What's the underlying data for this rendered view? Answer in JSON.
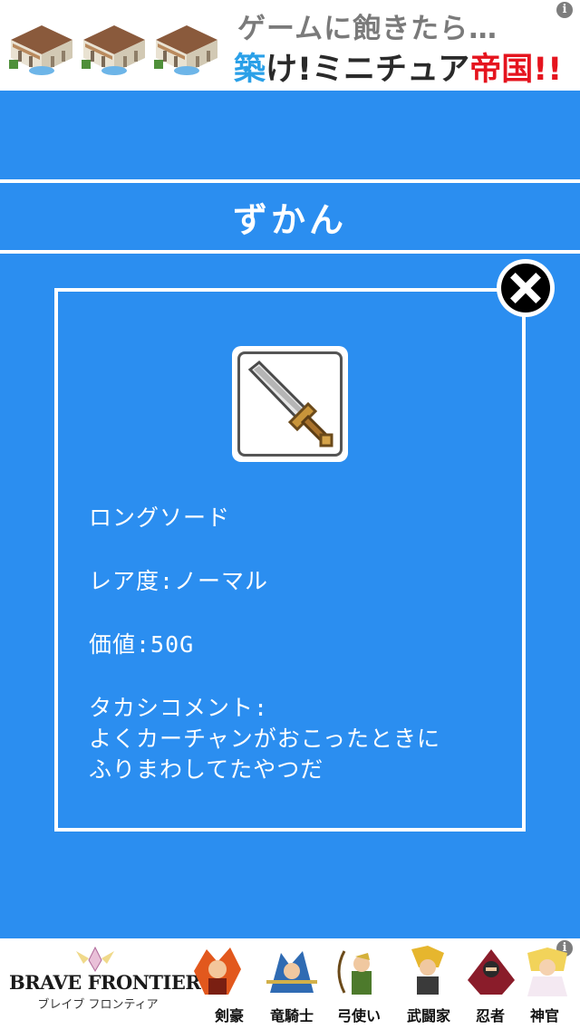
{
  "top_ad": {
    "line1": "ゲームに飽きたら…",
    "line2_part1": "築",
    "line2_part2": "け!ミニチュア",
    "line2_part3": "帝国",
    "line2_part4": "!!",
    "info": "i"
  },
  "header": {
    "title": "ずかん"
  },
  "item": {
    "icon": "sword-icon",
    "name": "ロングソード",
    "rarity": "レア度:ノーマル",
    "price": "価値:50G",
    "comment_label": "タカシコメント:",
    "comment_line1": "よくカーチャンがおこったときに",
    "comment_line2": "ふりまわしてたやつだ"
  },
  "close_icon": "close-icon",
  "bottom_ad": {
    "logo_title": "BRAVE FRONTIER",
    "logo_subtitle": "ブレイブ フロンティア",
    "info": "i",
    "characters": [
      "剣豪",
      "竜騎士",
      "弓使い",
      "武闘家",
      "忍者",
      "神官"
    ]
  },
  "colors": {
    "background": "#2b8ef0",
    "text": "#ffffff",
    "ad_red": "#e5141e",
    "ad_blue": "#2aa0e8"
  }
}
